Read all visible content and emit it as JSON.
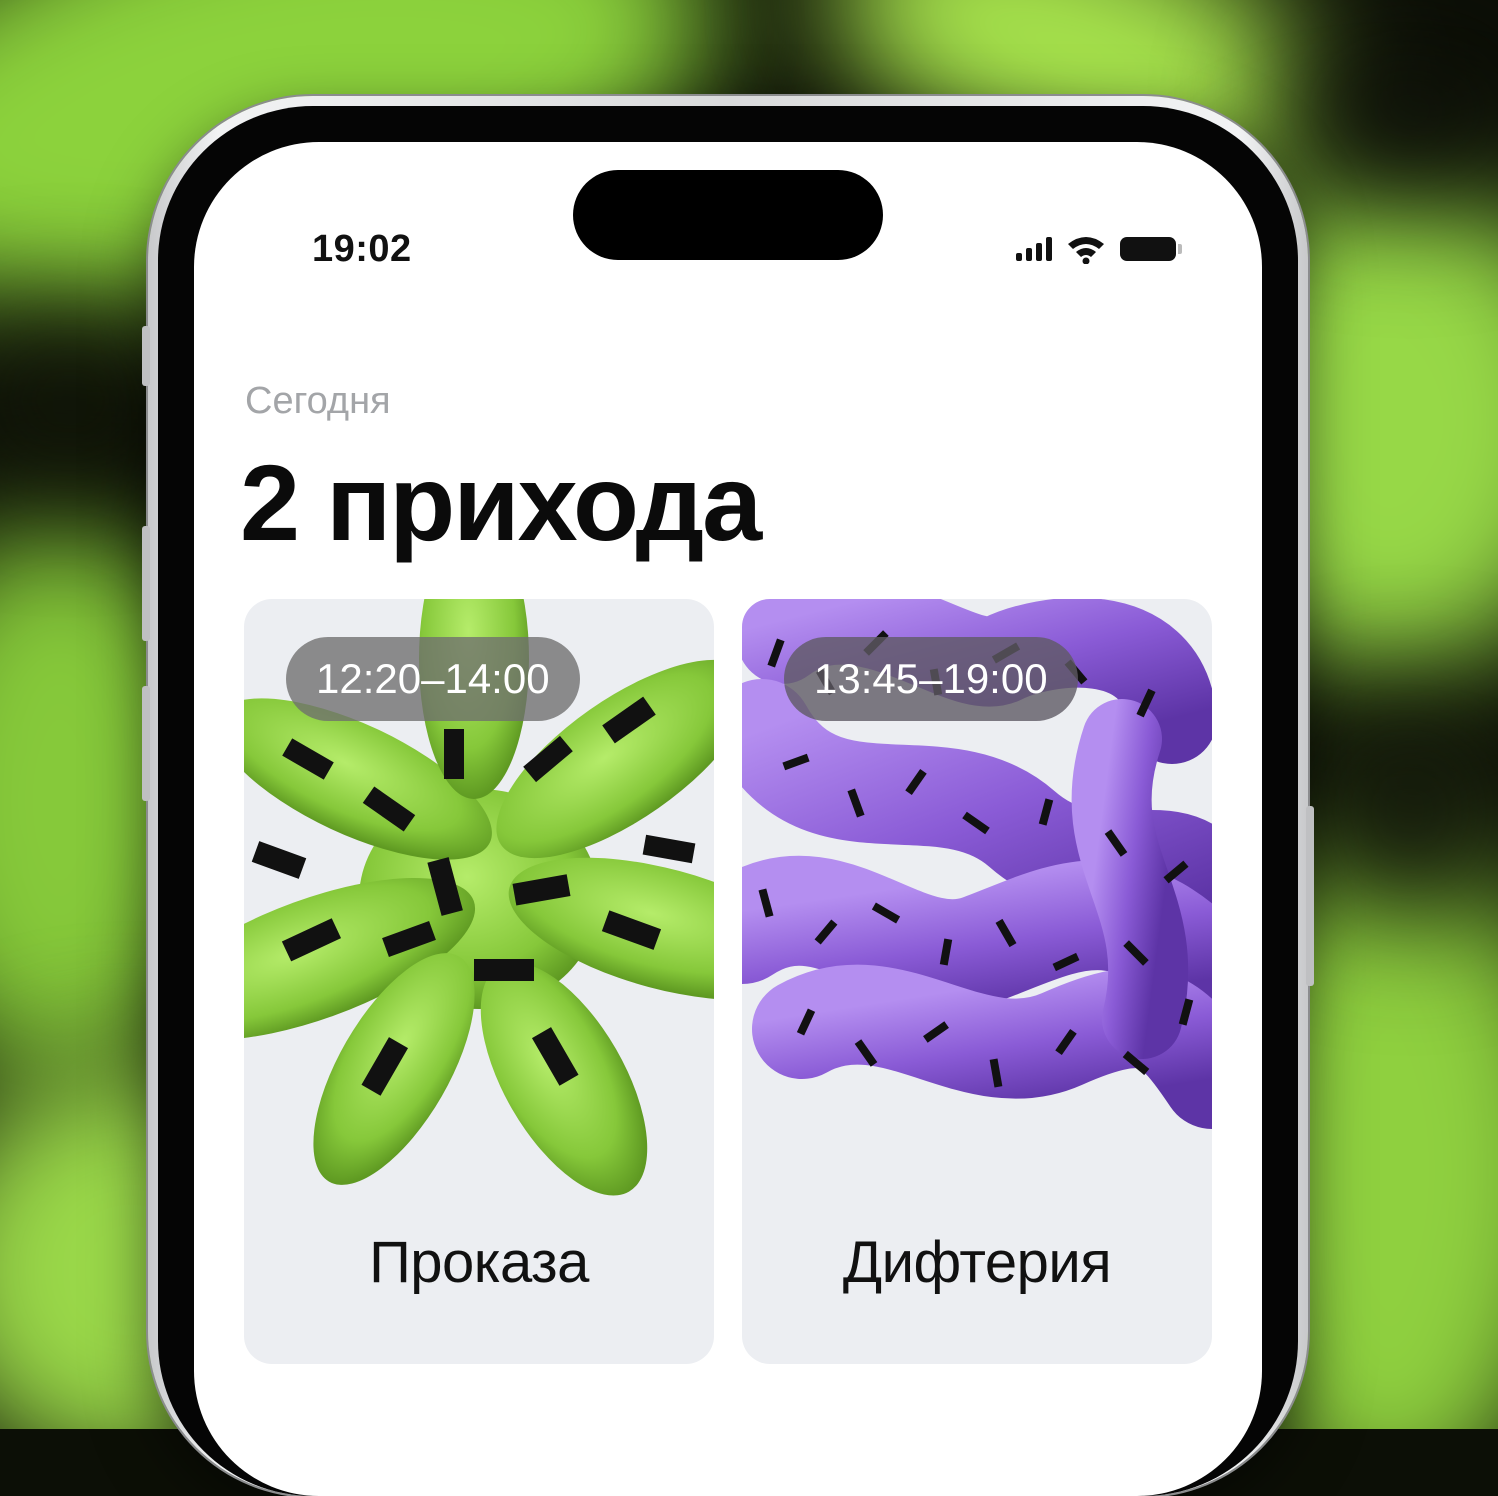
{
  "status_bar": {
    "time": "19:02",
    "icons": [
      "cellular-signal-icon",
      "wifi-icon",
      "battery-icon"
    ]
  },
  "header": {
    "subtitle": "Сегодня",
    "title": "2 прихода"
  },
  "cards": [
    {
      "time_range": "12:20–14:00",
      "name": "Проказа",
      "art": "green-striped-blob-illustration",
      "art_color": "#8fd13f"
    },
    {
      "time_range": "13:45–19:00",
      "name": "Дифтерия",
      "art": "purple-dotted-blob-illustration",
      "art_color": "#8a5bd6"
    }
  ],
  "colors": {
    "background_accent": "#8cd23c",
    "card_background": "#eceef2",
    "pill_background": "#6e6e6e"
  }
}
